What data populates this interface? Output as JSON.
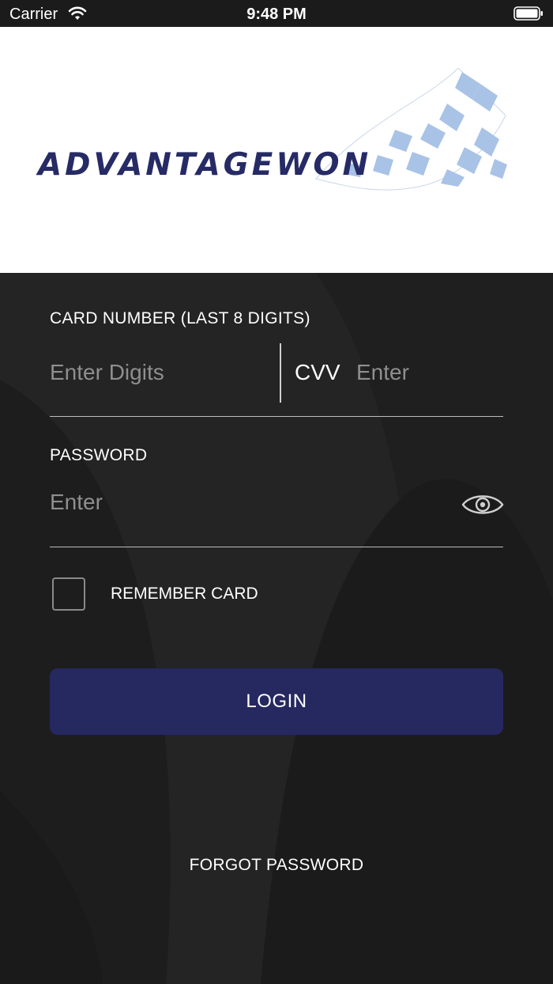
{
  "status_bar": {
    "carrier": "Carrier",
    "time": "9:48 PM"
  },
  "brand": {
    "name": "ADVANTAGEWON",
    "text_color": "#262b66",
    "flag_color": "#a9c3e6"
  },
  "login_form": {
    "card_label": "CARD NUMBER (LAST 8 DIGITS)",
    "card_placeholder": "Enter Digits",
    "cvv_label": "CVV",
    "cvv_placeholder": "Enter",
    "password_label": "PASSWORD",
    "password_placeholder": "Enter",
    "remember_label": "REMEMBER CARD",
    "login_label": "LOGIN",
    "forgot_label": "FORGOT PASSWORD",
    "button_color": "#262860",
    "background_color": "#232323"
  },
  "icons": {
    "wifi": "wifi-icon",
    "battery": "battery-icon",
    "password_visibility": "eye-icon"
  }
}
